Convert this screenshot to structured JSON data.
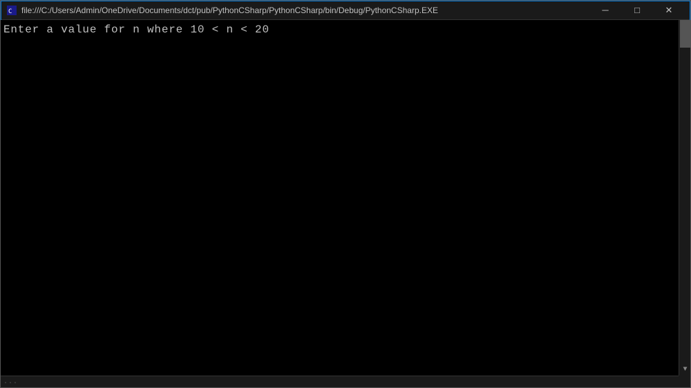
{
  "titlebar": {
    "icon_label": "terminal-icon",
    "title": "file:///C:/Users/Admin/OneDrive/Documents/dct/pub/PythonCSharp/PythonCSharp/bin/Debug/PythonCSharp.EXE",
    "minimize_label": "─",
    "maximize_label": "□",
    "close_label": "✕"
  },
  "console": {
    "line1": "Enter a value for n where 10 < n < 20"
  },
  "scrollbar": {
    "dots": "..."
  }
}
